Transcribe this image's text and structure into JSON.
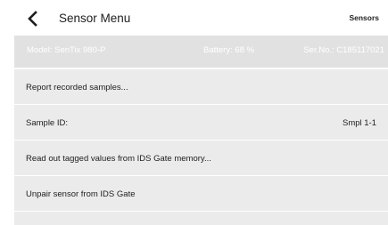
{
  "header": {
    "title": "Sensor Menu",
    "right_link": "Sensors",
    "back_icon": "chevron-left-icon"
  },
  "info": {
    "model": "Model: SenTix 980-P",
    "battery": "Battery: 68 %",
    "serial": "Ser.No.: C185117021"
  },
  "menu": {
    "items": [
      {
        "label": "Report recorded samples..."
      },
      {
        "label": "Sample ID:",
        "value": "Smpl 1-1"
      },
      {
        "label": "Read out tagged values from IDS Gate memory..."
      },
      {
        "label": "Unpair sensor from IDS Gate"
      }
    ]
  },
  "colors": {
    "background": "#ffffff",
    "info_bar": "#e1e1e1",
    "row": "#ebebeb",
    "text": "#1e1e1e"
  }
}
